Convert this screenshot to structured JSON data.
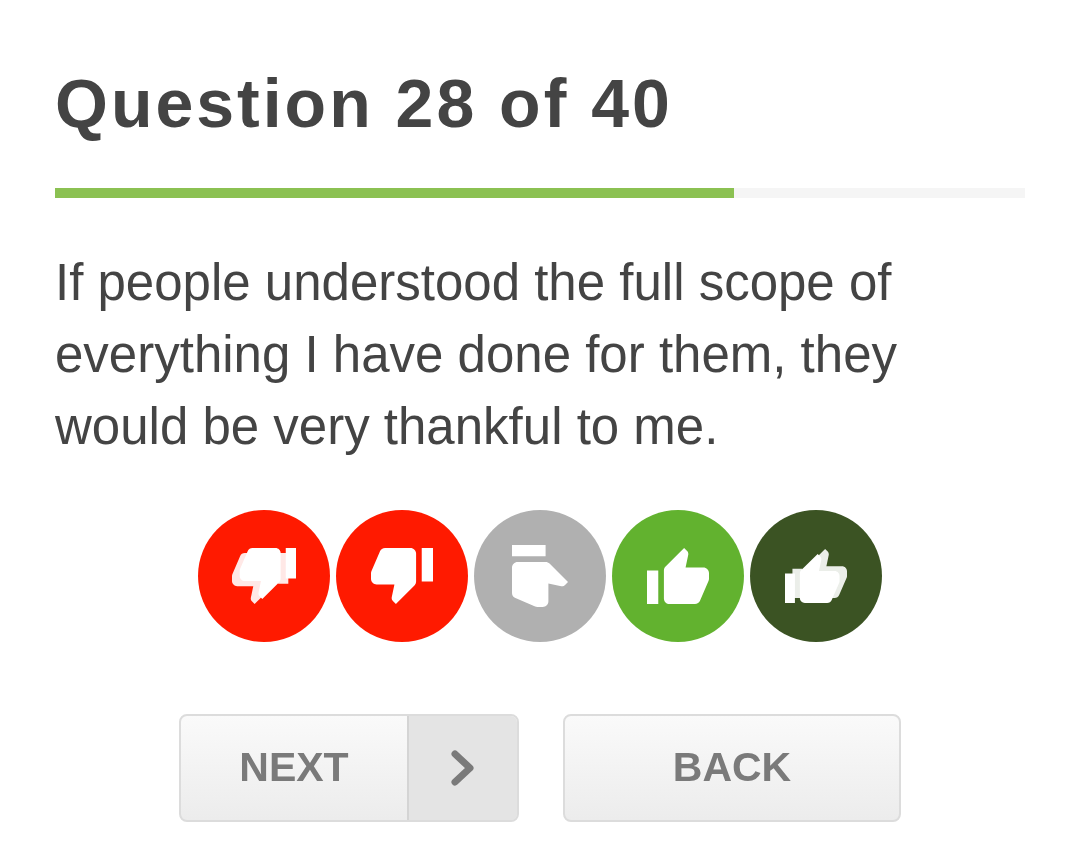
{
  "title": "Question 28 of 40",
  "progress": {
    "level": 0.7
  },
  "question": "If people understood the full scope of everything I have done for them, they would be very thankful to me.",
  "answers": [
    {
      "kind": "double-down",
      "color": "#ff1a00"
    },
    {
      "kind": "down",
      "color": "#ff1a00"
    },
    {
      "kind": "sideways",
      "color": "#b0b0b0"
    },
    {
      "kind": "up",
      "color": "#62b22f"
    },
    {
      "kind": "double-up",
      "color": "#3b5323"
    }
  ],
  "buttons": [
    {
      "kind": "next",
      "label": "NEXT"
    },
    {
      "kind": "back",
      "label": "BACK"
    }
  ]
}
